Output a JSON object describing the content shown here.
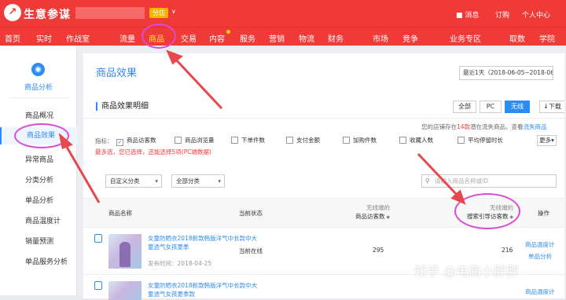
{
  "header": {
    "logo_mark": "↗",
    "logo_text": "生意参谋",
    "shop_tag": "分店",
    "shop_caret": "∨",
    "right": {
      "message": "消息",
      "order": "订购",
      "profile": "个人中心"
    }
  },
  "nav": [
    {
      "label": "首页"
    },
    {
      "label": "实时"
    },
    {
      "label": "作战室"
    },
    {
      "label": "流量"
    },
    {
      "label": "商品"
    },
    {
      "label": "交易"
    },
    {
      "label": "内容"
    },
    {
      "label": "服务"
    },
    {
      "label": "营销"
    },
    {
      "label": "物流"
    },
    {
      "label": "财务"
    },
    {
      "label": "市场"
    },
    {
      "label": "竞争"
    },
    {
      "label": "业务专区"
    },
    {
      "label": "取数"
    },
    {
      "label": "学院"
    }
  ],
  "sidebar": {
    "icon": "chart-icon",
    "title": "商品分析",
    "items": [
      "商品概况",
      "商品效果",
      "异常商品",
      "分类分析",
      "单品分析",
      "商品温度计",
      "销量预测",
      "单品服务分析"
    ],
    "active_index": 1
  },
  "main": {
    "page_title": "商品效果",
    "date_range": "最近1天（2018-06-05~2018-06-05）",
    "section_title": "商品效果明细",
    "segments": [
      "全部",
      "PC",
      "无线"
    ],
    "active_segment": "无线",
    "download": "下载",
    "lost_note": {
      "prefix": "您的店铺存在",
      "count": "14款",
      "middle": "潜在流失商品，查看",
      "link": "流失商品"
    },
    "indicator_label": "指标：",
    "indicators": [
      {
        "label": "商品访客数",
        "checked": true
      },
      {
        "label": "商品浏览量",
        "checked": false
      },
      {
        "label": "下单件数",
        "checked": false
      },
      {
        "label": "支付金额",
        "checked": false
      },
      {
        "label": "加购件数",
        "checked": false
      },
      {
        "label": "收藏人数",
        "checked": false
      },
      {
        "label": "平均停留时长",
        "checked": false
      }
    ],
    "more": "更多",
    "indicator_warning": "最多选，您已选择，还能选择5项(PC端数据)",
    "filters": {
      "category": "自定义分类",
      "all_category": "全部分类",
      "search_placeholder": "请输入商品名称或ID"
    },
    "table": {
      "headers": {
        "name": "商品名称",
        "status": "当前状态",
        "visitors_top": "无线端的",
        "visitors_sub": "商品访客数",
        "search_top": "无线端的",
        "search_sub": "搜索引导访客数",
        "ops": "操作"
      },
      "rows": [
        {
          "name": "女童防晒衣2018新款韩版洋气中长款中大童透气女孩夏季",
          "time": "发布时间：2018-04-25",
          "status": "当前在线",
          "visitors": "295",
          "search": "216",
          "ops": [
            "商品温度计",
            "单品分析"
          ]
        },
        {
          "name": "女童防晒衣2018新款韩版洋气中长款中大童透气女孩夏季款",
          "time": "",
          "status": "",
          "visitors": "",
          "search": "",
          "ops": [
            "商品温度计"
          ]
        }
      ]
    }
  },
  "watermark": "知乎 @电商小胖胖",
  "colors": {
    "brand_red": "#f03a38",
    "accent_blue": "#2d8cf0",
    "annotation": "#d94ad9",
    "arrow": "#e5484d"
  }
}
